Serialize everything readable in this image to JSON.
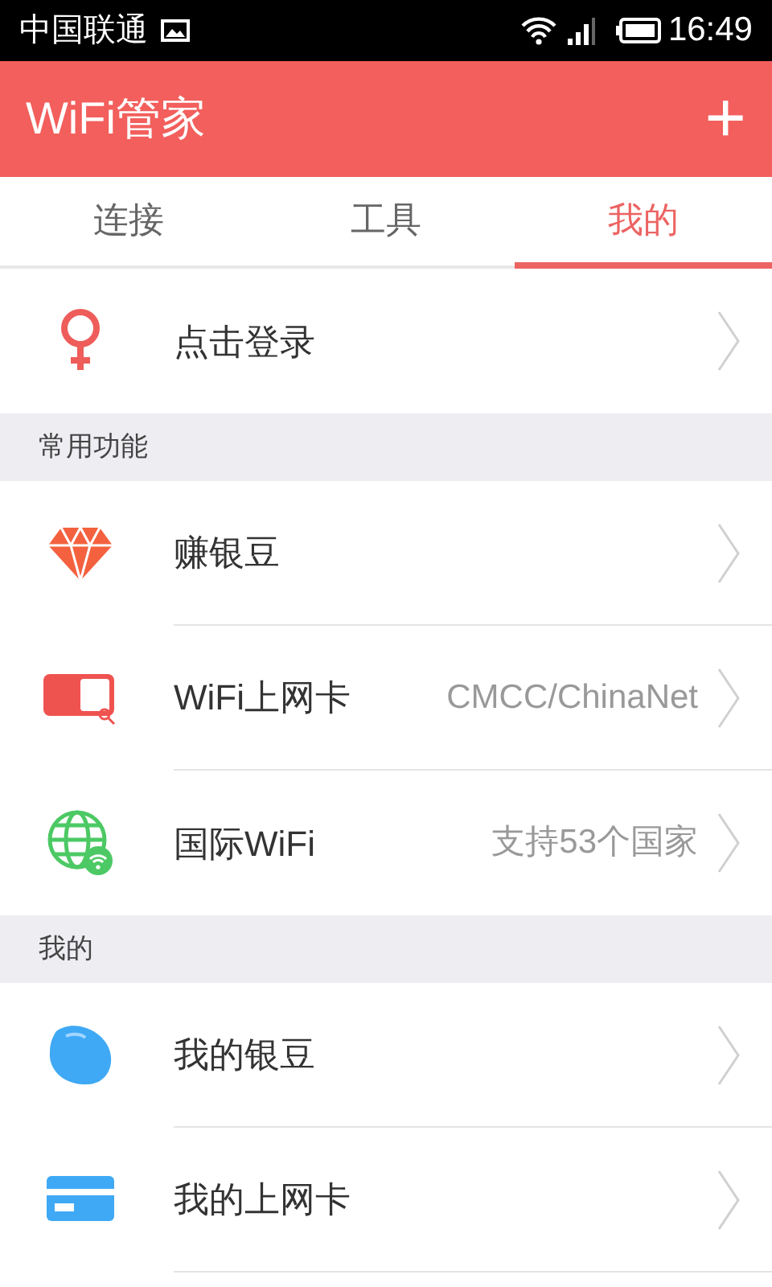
{
  "status_bar": {
    "carrier": "中国联通",
    "time": "16:49"
  },
  "header": {
    "title": "WiFi管家",
    "action": "+"
  },
  "tabs": [
    {
      "label": "连接",
      "selected": false
    },
    {
      "label": "工具",
      "selected": false
    },
    {
      "label": "我的",
      "selected": true
    }
  ],
  "sections": [
    {
      "items": [
        {
          "kind": "login",
          "label": "点击登录"
        }
      ]
    },
    {
      "title": "常用功能",
      "items": [
        {
          "kind": "earn",
          "label": "赚银豆"
        },
        {
          "kind": "wificard",
          "label": "WiFi上网卡",
          "detail": "CMCC/ChinaNet"
        },
        {
          "kind": "international",
          "label": "国际WiFi",
          "detail": "支持53个国家"
        }
      ]
    },
    {
      "title": "我的",
      "items": [
        {
          "kind": "beans",
          "label": "我的银豆"
        },
        {
          "kind": "cards",
          "label": "我的上网卡"
        }
      ]
    }
  ]
}
